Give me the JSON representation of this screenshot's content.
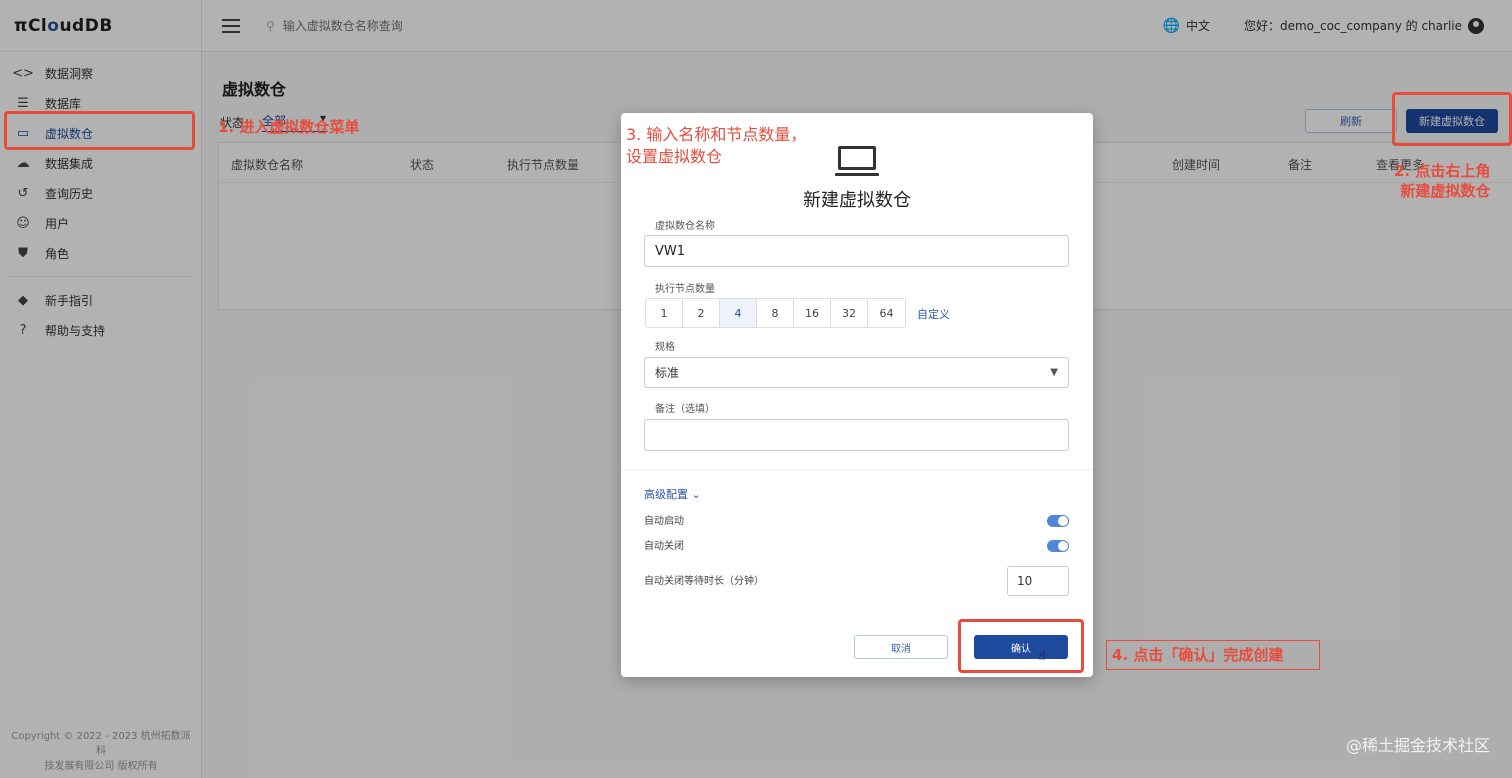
{
  "app": {
    "logo_prefix": "π",
    "logo_main": "Cl",
    "logo_mid": "o",
    "logo_end": "udDB"
  },
  "sidebar": {
    "items": [
      {
        "label": "数据洞察",
        "icon": "code-icon"
      },
      {
        "label": "数据库",
        "icon": "database-icon"
      },
      {
        "label": "虚拟数仓",
        "icon": "laptop-icon",
        "active": true
      },
      {
        "label": "数据集成",
        "icon": "cloud-upload-icon"
      },
      {
        "label": "查询历史",
        "icon": "history-icon"
      },
      {
        "label": "用户",
        "icon": "face-icon"
      },
      {
        "label": "角色",
        "icon": "role-shield-icon"
      }
    ],
    "help_items": [
      {
        "label": "新手指引",
        "icon": "direction-icon"
      },
      {
        "label": "帮助与支持",
        "icon": "help-icon"
      }
    ],
    "copyright_line1": "Copyright © 2022 - 2023 杭州拓数派科",
    "copyright_line2": "技发展有限公司 版权所有"
  },
  "topbar": {
    "search_placeholder": "输入虚拟数仓名称查询",
    "lang": "中文",
    "greeting": "您好：demo_coc_company 的 charlie"
  },
  "main": {
    "title": "虚拟数仓",
    "status_label": "状态：",
    "status_value": "全部",
    "refresh_label": "刷新",
    "new_label": "新建虚拟数仓",
    "columns": [
      "虚拟数仓名称",
      "状态",
      "执行节点数量",
      "创建时间",
      "备注",
      "查看更多"
    ]
  },
  "modal": {
    "title": "新建虚拟数仓",
    "name_label": "虚拟数仓名称",
    "name_value": "VW1",
    "nodes_label": "执行节点数量",
    "node_options": [
      "1",
      "2",
      "4",
      "8",
      "16",
      "32",
      "64"
    ],
    "node_selected": "4",
    "custom_label": "自定义",
    "spec_label": "规格",
    "spec_value": "标准",
    "note_label": "备注（选填）",
    "note_value": "",
    "advanced_label": "高级配置",
    "auto_start_label": "自动启动",
    "auto_start_on": true,
    "auto_stop_label": "自动关闭",
    "auto_stop_on": true,
    "wait_label": "自动关闭等待时长（分钟）",
    "wait_value": "10",
    "cancel_label": "取消",
    "ok_label": "确认"
  },
  "annotations": {
    "step1": "1. 进入虚拟数仓菜单",
    "step2_line1": "2. 点击右上角",
    "step2_line2": "新建虚拟数仓",
    "step3_line1": "3. 输入名称和节点数量，",
    "step3_line2": "设置虚拟数仓",
    "step4": "4. 点击「确认」完成创建",
    "color": "#e74c3c"
  },
  "watermark": "@稀土掘金技术社区"
}
